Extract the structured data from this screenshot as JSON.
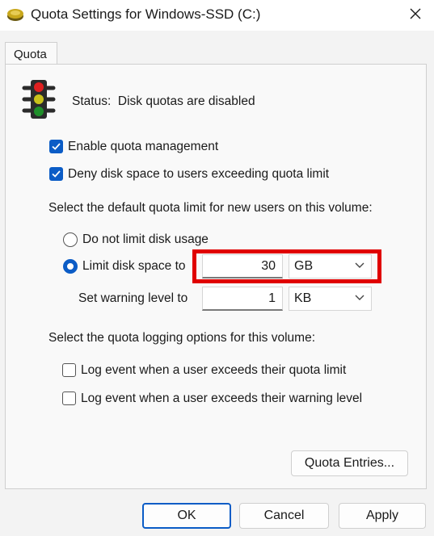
{
  "window": {
    "title": "Quota Settings for Windows-SSD (C:)",
    "title_icon": "drive-icon",
    "close_icon": "close-icon"
  },
  "tabs": [
    {
      "label": "Quota",
      "selected": true
    }
  ],
  "status": {
    "icon": "traffic-light-icon",
    "label": "Status:",
    "text": "Disk quotas are disabled"
  },
  "options": {
    "enable_quota": {
      "label": "Enable quota management",
      "checked": true
    },
    "deny_space": {
      "label": "Deny disk space to users exceeding quota limit",
      "checked": true
    }
  },
  "default_limit": {
    "heading": "Select the default quota limit for new users on this volume:",
    "no_limit": {
      "label": "Do not limit disk usage",
      "selected": false
    },
    "limit": {
      "label": "Limit disk space to",
      "selected": true,
      "value": "30",
      "unit": "GB"
    },
    "warning": {
      "label": "Set warning level to",
      "value": "1",
      "unit": "KB"
    }
  },
  "logging": {
    "heading": "Select the quota logging options for this volume:",
    "log_quota": {
      "label": "Log event when a user exceeds their quota limit",
      "checked": false
    },
    "log_warning": {
      "label": "Log event when a user exceeds their warning level",
      "checked": false
    }
  },
  "buttons": {
    "quota_entries": "Quota Entries...",
    "ok": "OK",
    "cancel": "Cancel",
    "apply": "Apply"
  },
  "colors": {
    "accent": "#0b5cc6",
    "highlight": "#e00000"
  }
}
